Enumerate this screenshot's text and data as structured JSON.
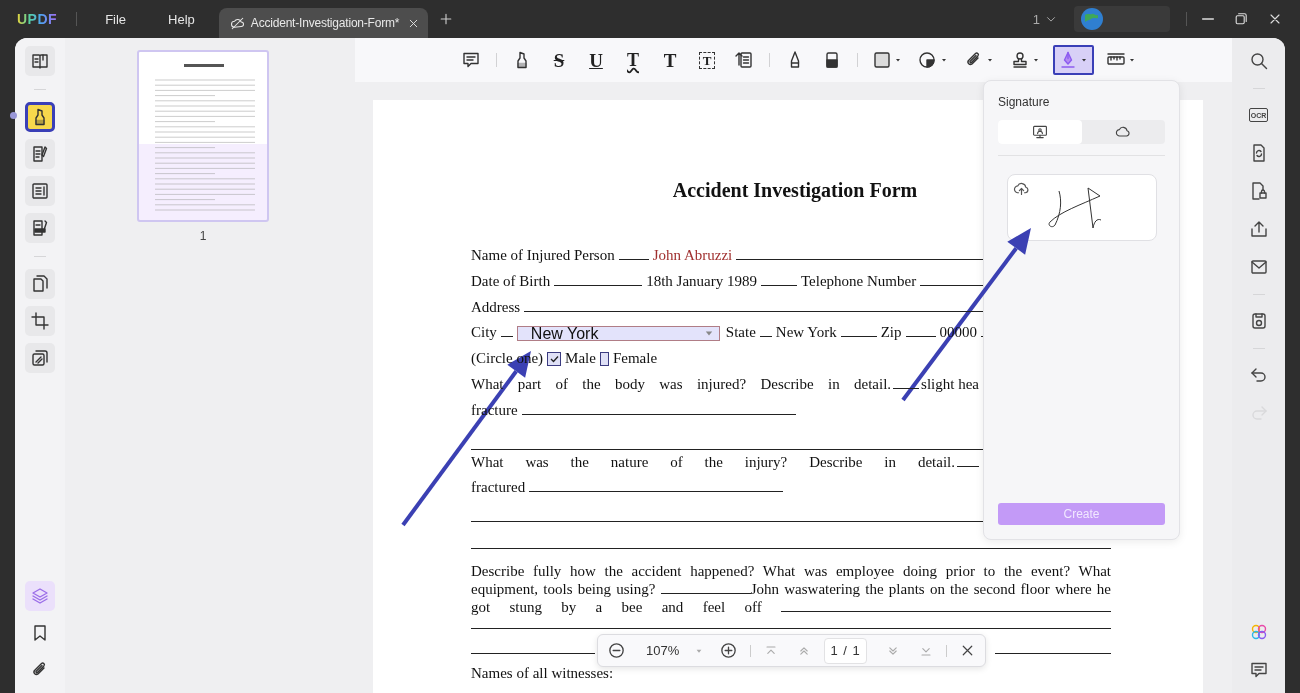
{
  "title_bar": {
    "logo": "UPDF",
    "menu": [
      "File",
      "Help"
    ],
    "tabs": [
      {
        "title": "Accident-Investigation-Form*",
        "selected": true
      }
    ],
    "window_count": "1"
  },
  "left_rail": {
    "groups": [
      [
        {
          "kind": "reader",
          "selected": false
        }
      ],
      [
        {
          "kind": "highlight",
          "selected": true
        },
        {
          "kind": "edit",
          "selected": false
        },
        {
          "kind": "form",
          "selected": false
        },
        {
          "kind": "redact",
          "selected": false
        }
      ],
      [
        {
          "kind": "organize",
          "selected": false
        },
        {
          "kind": "crop",
          "selected": false
        },
        {
          "kind": "watermark",
          "selected": false
        }
      ]
    ],
    "bottom": [
      {
        "kind": "layers",
        "selected": true
      },
      {
        "kind": "bookmark",
        "selected": false
      },
      {
        "kind": "attachment",
        "selected": false
      }
    ]
  },
  "thumbnails": [
    {
      "label": "1",
      "selected": true
    }
  ],
  "toolbar": {
    "groups": [
      [
        {
          "kind": "comment",
          "selected": false,
          "menu": false
        }
      ],
      [
        {
          "kind": "highlight",
          "selected": false,
          "menu": false
        },
        {
          "kind": "strikethrough",
          "glyph": "S",
          "selected": false,
          "menu": false
        },
        {
          "kind": "underline",
          "glyph": "U",
          "selected": false,
          "menu": false
        },
        {
          "kind": "squiggly",
          "glyph": "T",
          "selected": false,
          "menu": false
        },
        {
          "kind": "text",
          "glyph": "T",
          "selected": false,
          "menu": false
        },
        {
          "kind": "textbox",
          "glyph": "T",
          "selected": false,
          "menu": false
        },
        {
          "kind": "callout",
          "selected": false,
          "menu": false
        }
      ],
      [
        {
          "kind": "pencil",
          "selected": false,
          "menu": false
        },
        {
          "kind": "eraser",
          "selected": false,
          "menu": false
        }
      ],
      [
        {
          "kind": "rectangle",
          "selected": false,
          "menu": true
        },
        {
          "kind": "shape",
          "selected": false,
          "menu": true
        },
        {
          "kind": "attachment",
          "selected": false,
          "menu": true
        },
        {
          "kind": "stamp",
          "selected": false,
          "menu": true
        },
        {
          "kind": "signature",
          "selected": true,
          "menu": true
        },
        {
          "kind": "measure",
          "selected": false,
          "menu": true
        }
      ]
    ]
  },
  "document": {
    "title": "Accident Investigation Form",
    "rows": [
      {
        "kind": "line",
        "parts": [
          {
            "kind": "text",
            "text": "Name of Injured Person"
          },
          {
            "kind": "blank"
          },
          {
            "kind": "entry",
            "text": "John Abruzzi"
          },
          {
            "kind": "blank"
          }
        ]
      },
      {
        "kind": "line",
        "parts": [
          {
            "kind": "text",
            "text": "Date of Birth"
          },
          {
            "kind": "blank"
          },
          {
            "kind": "text",
            "text": "18th January 1989"
          },
          {
            "kind": "blank"
          },
          {
            "kind": "text",
            "text": "Telephone Number"
          },
          {
            "kind": "blank"
          }
        ]
      },
      {
        "kind": "line",
        "parts": [
          {
            "kind": "text",
            "text": "Address"
          },
          {
            "kind": "blank"
          }
        ]
      },
      {
        "kind": "line",
        "parts": [
          {
            "kind": "text",
            "text": "City"
          },
          {
            "kind": "blank"
          },
          {
            "kind": "dropdown",
            "value": "New York"
          },
          {
            "kind": "text",
            "text": "State"
          },
          {
            "kind": "blank"
          },
          {
            "kind": "text",
            "text": "New York"
          },
          {
            "kind": "blank"
          },
          {
            "kind": "text",
            "text": "Zip"
          },
          {
            "kind": "blank"
          },
          {
            "kind": "text",
            "text": "00000"
          },
          {
            "kind": "blank"
          }
        ]
      },
      {
        "kind": "line",
        "parts": [
          {
            "kind": "text",
            "text": "(Circle one)"
          },
          {
            "kind": "checkbox",
            "checked": true
          },
          {
            "kind": "text",
            "text": "Male"
          },
          {
            "kind": "checkbox",
            "checked": false
          },
          {
            "kind": "text",
            "text": "Female"
          }
        ]
      },
      {
        "kind": "spaced",
        "parts": [
          {
            "kind": "text",
            "text": "What part of the body was injured?  Describe in detail."
          },
          {
            "kind": "blank"
          },
          {
            "kind": "text",
            "text": "slight hea"
          }
        ]
      },
      {
        "kind": "line",
        "parts": [
          {
            "kind": "text",
            "text": "fracture"
          },
          {
            "kind": "blank"
          }
        ]
      },
      {
        "kind": "rule"
      },
      {
        "kind": "spaced",
        "parts": [
          {
            "kind": "text",
            "text": "What was the nature of the injury?  Describe in detail."
          },
          {
            "kind": "blank"
          }
        ]
      },
      {
        "kind": "line",
        "parts": [
          {
            "kind": "text",
            "text": "fractured"
          },
          {
            "kind": "blank"
          }
        ]
      },
      {
        "kind": "rule"
      },
      {
        "kind": "rule"
      },
      {
        "kind": "paragraph",
        "parts": [
          {
            "kind": "text",
            "text": "Describe fully how the accident happened? What was employee doing prior to the event? What equipment, tools being using?"
          },
          {
            "kind": "blank"
          },
          {
            "kind": "text",
            "text": "John waswatering the plants on the second floor where he got stung by a bee and feel off"
          },
          {
            "kind": "blank"
          }
        ]
      },
      {
        "kind": "rule"
      },
      {
        "kind": "rule"
      },
      {
        "kind": "line",
        "parts": [
          {
            "kind": "text",
            "text": "Names of all witnesses:"
          }
        ]
      }
    ]
  },
  "right_rail": {
    "groups": [
      [
        {
          "kind": "search",
          "disabled": false
        }
      ],
      [
        {
          "kind": "ocr",
          "glyph": "OCR",
          "disabled": false
        },
        {
          "kind": "convert",
          "disabled": false
        },
        {
          "kind": "protect",
          "disabled": false
        },
        {
          "kind": "share",
          "disabled": false
        },
        {
          "kind": "mail",
          "disabled": false
        }
      ],
      [
        {
          "kind": "save",
          "disabled": false
        }
      ],
      [
        {
          "kind": "undo",
          "disabled": false
        },
        {
          "kind": "redo",
          "disabled": true
        }
      ]
    ],
    "bottom": [
      {
        "kind": "ai",
        "disabled": false
      },
      {
        "kind": "comment",
        "disabled": false
      }
    ]
  },
  "signature_panel": {
    "title": "Signature",
    "tabs": [
      {
        "kind": "device",
        "selected": true
      },
      {
        "kind": "cloud",
        "selected": false
      }
    ],
    "signatures": [
      {
        "synced": true
      }
    ],
    "create_button": {
      "label": "Create",
      "disabled": true
    }
  },
  "zoom_bar": {
    "zoom": "107%",
    "page": "1 / 1"
  },
  "annotations": [
    {
      "kind": "arrow"
    },
    {
      "kind": "arrow"
    }
  ]
}
